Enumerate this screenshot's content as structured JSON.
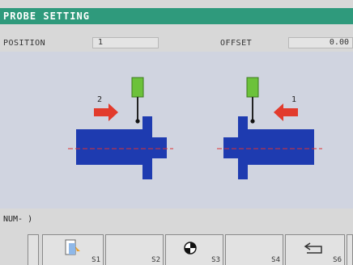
{
  "title": "PROBE SETTING",
  "position": {
    "label": "POSITION",
    "value": "1"
  },
  "offset": {
    "label": "OFFSET",
    "value": "0.00"
  },
  "diagram": {
    "left_probe_number": "2",
    "right_probe_number": "1",
    "colors": {
      "workpiece": "#1e3bb0",
      "probe_body": "#6cc23a",
      "arrow": "#e23b2c",
      "centerline": "#e03030"
    }
  },
  "num_input": {
    "label": "NUM-",
    "value": ")"
  },
  "softkeys": [
    {
      "label": "",
      "icon": "blank"
    },
    {
      "label": "S1",
      "icon": "probe-icon"
    },
    {
      "label": "S2",
      "icon": "blank"
    },
    {
      "label": "S3",
      "icon": "target-icon"
    },
    {
      "label": "S4",
      "icon": "blank"
    },
    {
      "label": "S6",
      "icon": "return-icon"
    },
    {
      "label": "",
      "icon": "blank"
    }
  ]
}
